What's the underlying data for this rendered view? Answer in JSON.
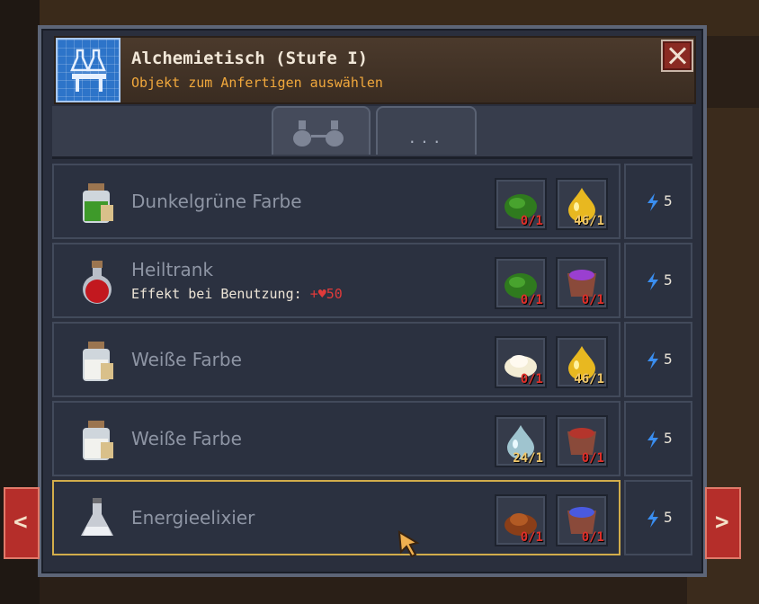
{
  "header": {
    "title": "Alchemietisch (Stufe I)",
    "subtitle": "Objekt zum Anfertigen auswählen"
  },
  "tabs": [
    {
      "icon": "alchemy-flasks-icon"
    },
    {
      "label": "..."
    }
  ],
  "recipes": [
    {
      "name": "Dunkelgrüne Farbe",
      "icon": "green-dye-bottle-icon",
      "ingredients": [
        {
          "icon": "green-herb-icon",
          "count": "0/1",
          "status": "missing"
        },
        {
          "icon": "yellow-drop-icon",
          "count": "46/1",
          "status": "ok"
        }
      ],
      "energy": "5"
    },
    {
      "name": "Heiltrank",
      "effect_label": "Effekt bei Benutzung:",
      "effect_value": "+♥50",
      "icon": "red-potion-icon",
      "ingredients": [
        {
          "icon": "green-herb-icon",
          "count": "0/1",
          "status": "missing"
        },
        {
          "icon": "purple-bowl-icon",
          "count": "0/1",
          "status": "missing"
        }
      ],
      "energy": "5"
    },
    {
      "name": "Weiße Farbe",
      "icon": "white-dye-bottle-icon",
      "ingredients": [
        {
          "icon": "white-powder-icon",
          "count": "0/1",
          "status": "missing"
        },
        {
          "icon": "yellow-drop-icon",
          "count": "46/1",
          "status": "ok"
        }
      ],
      "energy": "5"
    },
    {
      "name": "Weiße Farbe",
      "icon": "white-dye-bottle-icon",
      "ingredients": [
        {
          "icon": "water-drop-icon",
          "count": "24/1",
          "status": "ok"
        },
        {
          "icon": "red-bowl-icon",
          "count": "0/1",
          "status": "missing"
        }
      ],
      "energy": "5"
    },
    {
      "name": "Energieelixier",
      "icon": "clear-flask-icon",
      "selected": true,
      "ingredients": [
        {
          "icon": "brown-powder-icon",
          "count": "0/1",
          "status": "missing"
        },
        {
          "icon": "blue-bowl-icon",
          "count": "0/1",
          "status": "missing"
        }
      ],
      "energy": "5"
    }
  ],
  "colors": {
    "missing": "#e0302a",
    "ok": "#f1c86a",
    "accent": "#f1a83c",
    "selected_border": "#d2ad4b"
  }
}
